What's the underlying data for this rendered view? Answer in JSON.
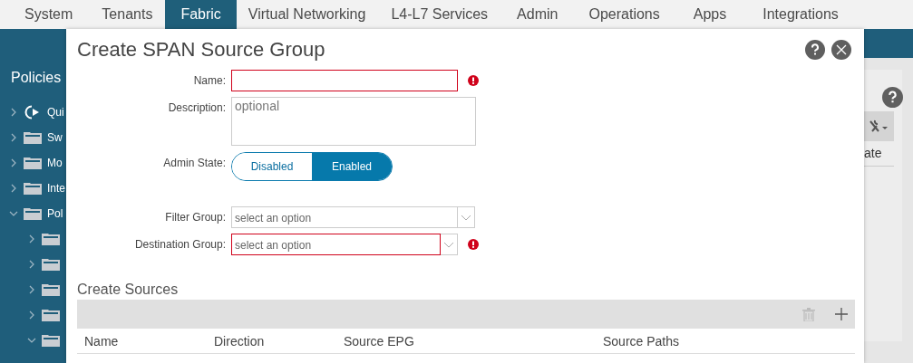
{
  "top_nav": {
    "tabs": [
      {
        "label": "System",
        "selected": false
      },
      {
        "label": "Tenants",
        "selected": false
      },
      {
        "label": "Fabric",
        "selected": true
      },
      {
        "label": "Virtual Networking",
        "selected": false
      },
      {
        "label": "L4-L7 Services",
        "selected": false
      },
      {
        "label": "Admin",
        "selected": false
      },
      {
        "label": "Operations",
        "selected": false
      },
      {
        "label": "Apps",
        "selected": false
      },
      {
        "label": "Integrations",
        "selected": false
      }
    ]
  },
  "sidebar": {
    "title": "Policies",
    "items": [
      {
        "label": "Qui",
        "kind": "quick-start",
        "expanded": false
      },
      {
        "label": "Sw",
        "kind": "folder",
        "expanded": false
      },
      {
        "label": "Mo",
        "kind": "folder",
        "expanded": false
      },
      {
        "label": "Inte",
        "kind": "folder",
        "expanded": false
      },
      {
        "label": "Pol",
        "kind": "folder",
        "expanded": true,
        "children": [
          {
            "kind": "folder",
            "expanded": false
          },
          {
            "kind": "folder",
            "expanded": false
          },
          {
            "kind": "folder",
            "expanded": false
          },
          {
            "kind": "folder",
            "expanded": false
          },
          {
            "kind": "folder",
            "expanded": true
          }
        ]
      }
    ]
  },
  "dialog": {
    "title": "Create SPAN Source Group",
    "fields": [
      {
        "kind": "text",
        "label": "Name:",
        "error": true
      },
      {
        "kind": "textarea",
        "label": "Description:",
        "placeholder": "optional",
        "error": false
      },
      {
        "kind": "toggle",
        "label": "Admin State:",
        "options": [
          {
            "label": "Disabled",
            "selected": false
          },
          {
            "label": "Enabled",
            "selected": true
          }
        ]
      },
      {
        "kind": "select",
        "label": "Filter Group:",
        "placeholder": "select an option",
        "error": false
      },
      {
        "kind": "select",
        "label": "Destination Group:",
        "placeholder": "select an option",
        "error": true
      }
    ],
    "sources": {
      "title": "Create Sources",
      "columns": [
        "Name",
        "Direction",
        "Source EPG",
        "Source Paths"
      ]
    }
  },
  "background_panel": {
    "column_1": "ate"
  }
}
